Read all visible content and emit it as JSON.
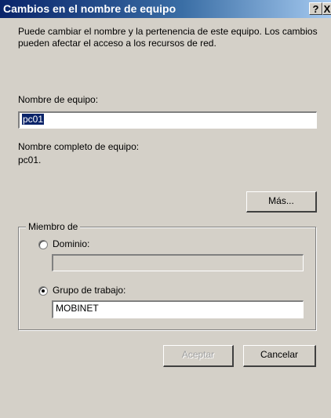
{
  "window": {
    "title": "Cambios en el nombre de equipo",
    "help_glyph": "?",
    "close_glyph": "X"
  },
  "description": "Puede cambiar el nombre y la pertenencia de este equipo. Los cambios pueden afectar el acceso a los recursos de red.",
  "computer_name": {
    "label": "Nombre de equipo:",
    "value": "pc01"
  },
  "full_name": {
    "label": "Nombre completo de equipo:",
    "value": "pc01."
  },
  "more_button": {
    "label": "Más..."
  },
  "member_of": {
    "legend": "Miembro de",
    "domain": {
      "label": "Dominio:",
      "value": "",
      "selected": false
    },
    "workgroup": {
      "label": "Grupo de trabajo:",
      "value": "MOBINET",
      "selected": true
    }
  },
  "buttons": {
    "ok": "Aceptar",
    "cancel": "Cancelar"
  },
  "colors": {
    "dialog_bg": "#d4d0c8",
    "titlebar_start": "#0a246a",
    "titlebar_end": "#a6caf0",
    "selection": "#0a246a"
  }
}
